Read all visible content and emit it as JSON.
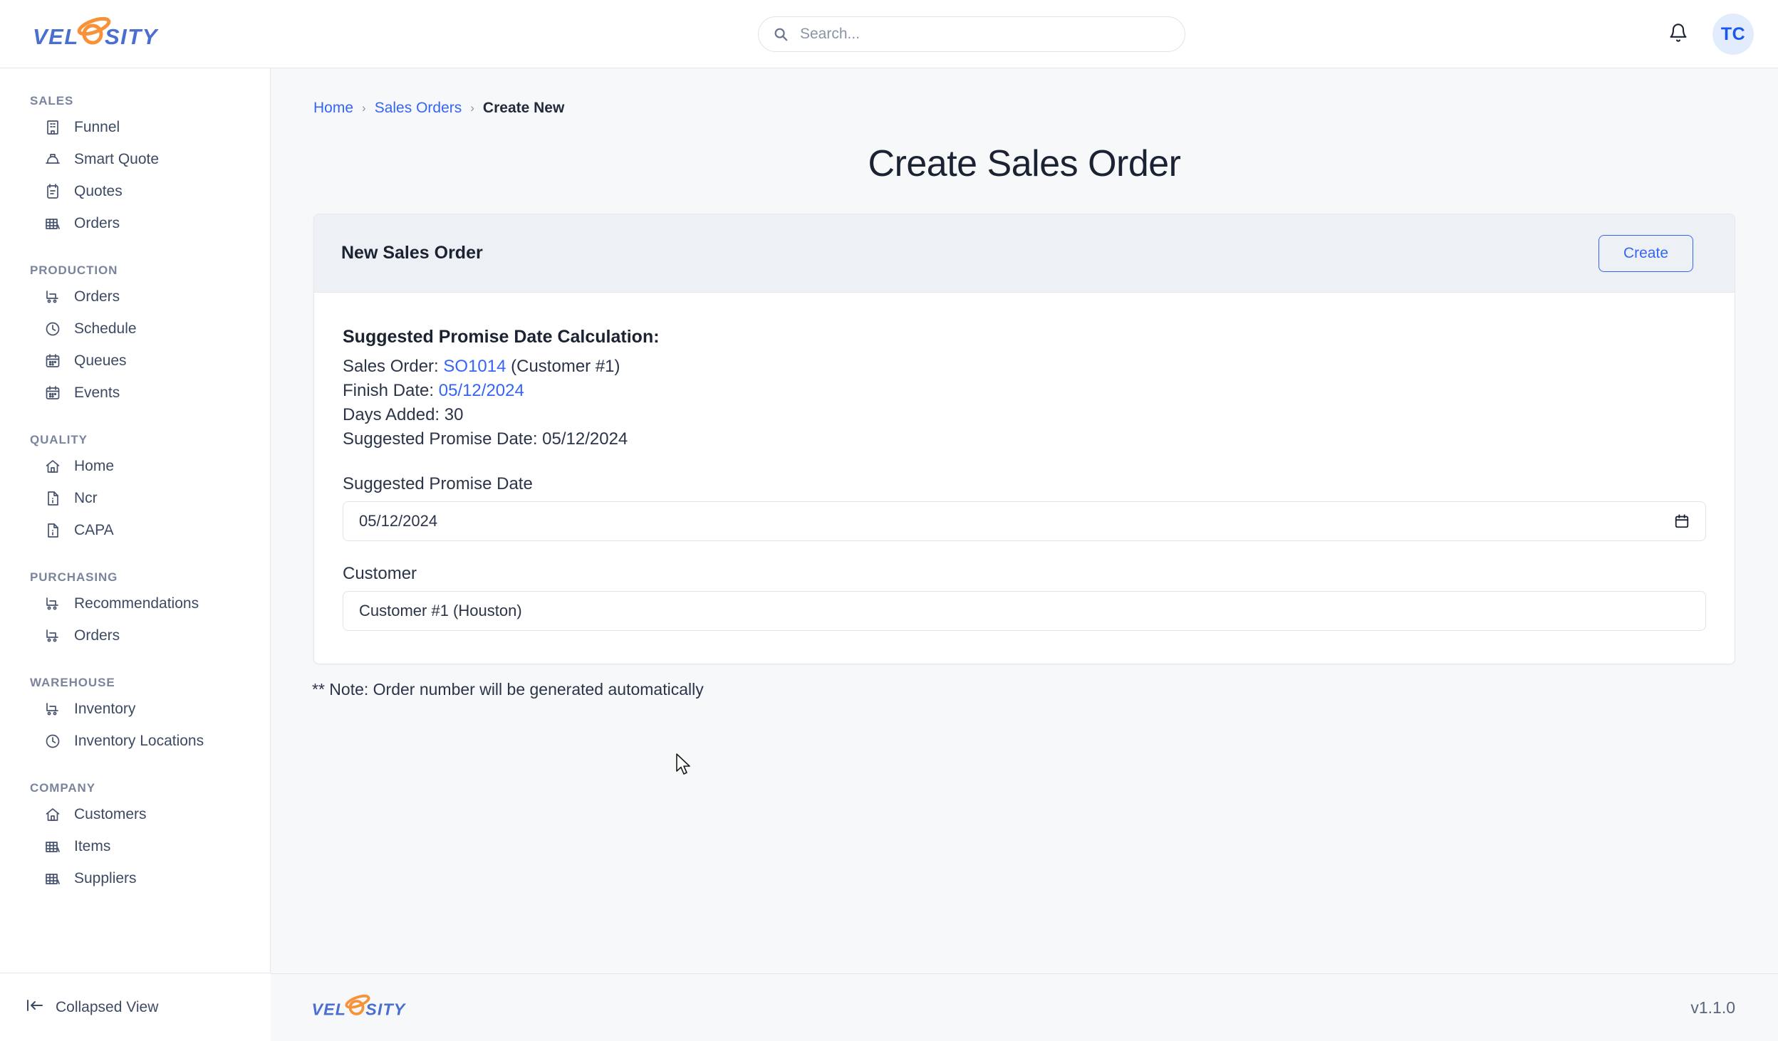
{
  "app": {
    "logo_text": "VELOSITY",
    "logo_alt": "velosity-logo"
  },
  "topbar": {
    "search_placeholder": "Search...",
    "search_value": "",
    "search_icon": "search-icon",
    "bell_icon": "bell-icon",
    "avatar_initials": "TC"
  },
  "sidebar": {
    "collapse_label": "Collapsed View",
    "collapse_icon": "collapse-left-icon",
    "sections": [
      {
        "title": "SALES",
        "items": [
          {
            "label": "Funnel",
            "icon": "building-icon"
          },
          {
            "label": "Smart Quote",
            "icon": "hardhat-icon"
          },
          {
            "label": "Quotes",
            "icon": "clipboard-icon"
          },
          {
            "label": "Orders",
            "icon": "warehouse-icon"
          }
        ]
      },
      {
        "title": "PRODUCTION",
        "items": [
          {
            "label": "Orders",
            "icon": "cart-icon"
          },
          {
            "label": "Schedule",
            "icon": "clock-icon"
          },
          {
            "label": "Queues",
            "icon": "calendar-icon"
          },
          {
            "label": "Events",
            "icon": "calendar-icon"
          }
        ]
      },
      {
        "title": "QUALITY",
        "items": [
          {
            "label": "Home",
            "icon": "home-icon"
          },
          {
            "label": "Ncr",
            "icon": "file-icon"
          },
          {
            "label": "CAPA",
            "icon": "file-icon"
          }
        ]
      },
      {
        "title": "PURCHASING",
        "items": [
          {
            "label": "Recommendations",
            "icon": "cart-icon"
          },
          {
            "label": "Orders",
            "icon": "cart-icon"
          }
        ]
      },
      {
        "title": "WAREHOUSE",
        "items": [
          {
            "label": "Inventory",
            "icon": "cart-icon"
          },
          {
            "label": "Inventory Locations",
            "icon": "clock-icon"
          }
        ]
      },
      {
        "title": "COMPANY",
        "items": [
          {
            "label": "Customers",
            "icon": "home-icon"
          },
          {
            "label": "Items",
            "icon": "warehouse-icon"
          },
          {
            "label": "Suppliers",
            "icon": "warehouse-icon"
          }
        ]
      }
    ]
  },
  "breadcrumb": {
    "items": [
      {
        "label": "Home",
        "type": "link"
      },
      {
        "label": "Sales Orders",
        "type": "link"
      },
      {
        "label": "Create New",
        "type": "current"
      }
    ],
    "separator": "›"
  },
  "page": {
    "title": "Create Sales Order"
  },
  "card": {
    "title": "New Sales Order",
    "create_label": "Create",
    "calculation": {
      "heading": "Suggested Promise Date Calculation:",
      "sales_order_label": "Sales Order: ",
      "sales_order_value": "SO1014",
      "sales_order_suffix": " (Customer #1)",
      "finish_date_label": "Finish Date: ",
      "finish_date_value": "05/12/2024",
      "days_added_line": "Days Added: 30",
      "suggested_line": "Suggested Promise Date: 05/12/2024"
    },
    "fields": [
      {
        "label": "Suggested Promise Date",
        "value": "05/12/2024",
        "kind": "date",
        "icon": "calendar-icon"
      },
      {
        "label": "Customer",
        "value": "Customer #1 (Houston)",
        "kind": "select",
        "icon": ""
      }
    ]
  },
  "note": "** Note: Order number will be generated automatically",
  "footer": {
    "version": "v1.1.0"
  },
  "colors": {
    "accent_blue": "#3565f6",
    "logo_blue": "#4a6fd1",
    "logo_orange": "#f79239",
    "page_bg": "#f6f8fa",
    "card_header_bg": "#edf1f6",
    "text": "#2b3448",
    "muted": "#7a849c"
  }
}
